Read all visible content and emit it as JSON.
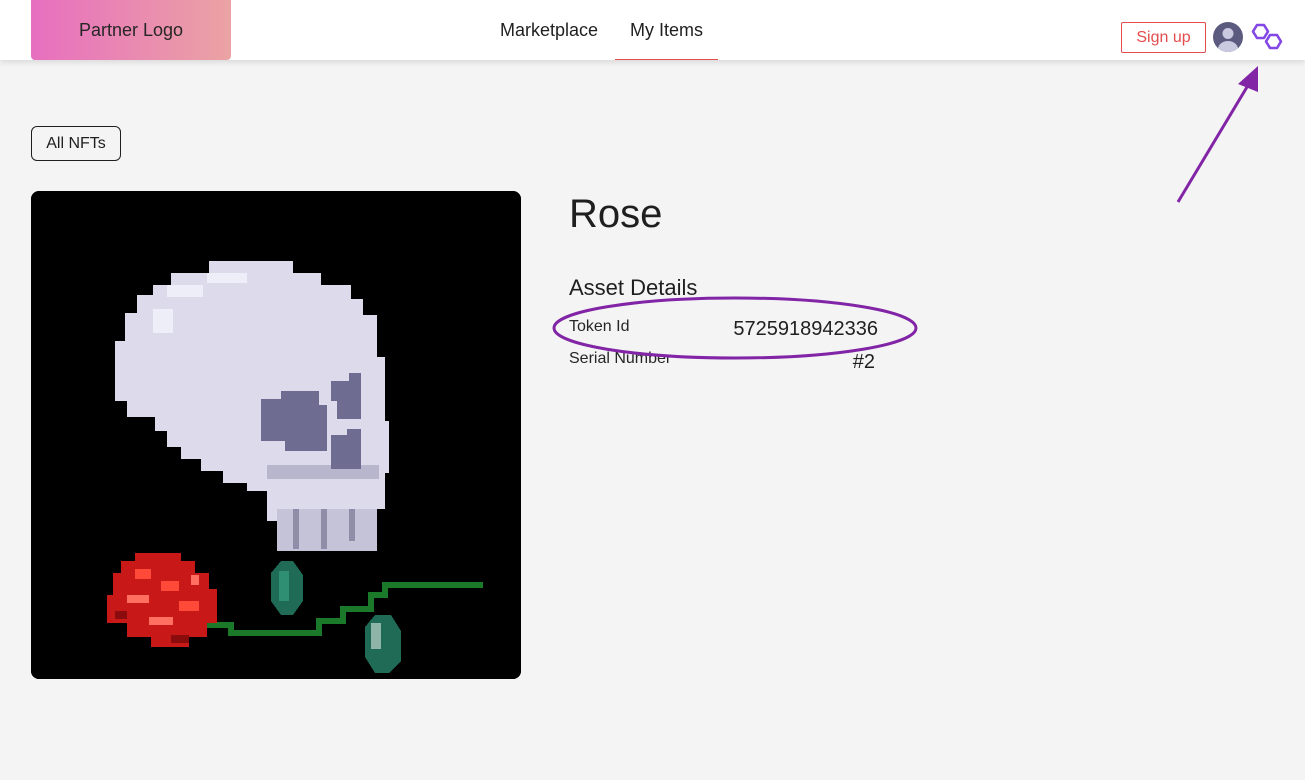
{
  "header": {
    "partner_logo": "Partner Logo",
    "nav": [
      {
        "label": "Marketplace",
        "active": false
      },
      {
        "label": "My Items",
        "active": true
      }
    ],
    "signup_label": "Sign up",
    "icons": [
      "avatar-icon",
      "polygon-logo-icon"
    ]
  },
  "toolbar": {
    "all_nfts_label": "All NFTs"
  },
  "asset": {
    "title": "Rose",
    "details_heading": "Asset Details",
    "token_id_label": "Token Id",
    "token_id_value": "5725918942336",
    "serial_label": "Serial Number",
    "serial_value": "#2"
  },
  "colors": {
    "accent": "#e34d4d",
    "annotation": "#8224a6",
    "polygon": "#8247e5"
  }
}
